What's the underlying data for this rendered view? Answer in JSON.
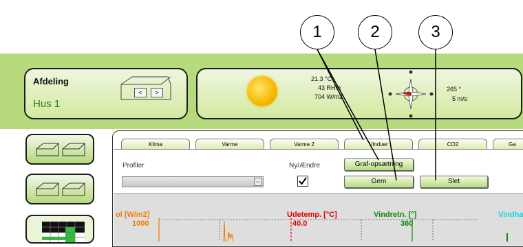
{
  "callouts": [
    "1",
    "2",
    "3"
  ],
  "department": {
    "title": "Afdeling",
    "house": "Hus 1",
    "prev": "<",
    "next": ">"
  },
  "weather": {
    "temperature": "21.3 °C",
    "humidity": "43 RH%",
    "radiation": "704 W/m2",
    "wind_direction": "265 °",
    "wind_speed": "5 m/s"
  },
  "tabs": [
    "Klima",
    "Varme",
    "Varme 2",
    "Vinduer",
    "CO2",
    "Ga"
  ],
  "controls": {
    "profiles_label": "Profiler",
    "new_edit_label": "Ny/Ændre",
    "graph_setup_button": "Graf-opsætning",
    "save_button": "Gem",
    "delete_button": "Slet",
    "checkbox_checked": true
  },
  "chart": {
    "sun_label": "ol [W/m2]",
    "sun_max": "1000",
    "outdoor_temp_label": "Udetemp. [°C]",
    "outdoor_temp_max": "40.0",
    "wind_dir_label": "Vindretn. [°]",
    "wind_dir_max": "360",
    "wind_speed_label": "Vindha"
  },
  "colors": {
    "band": "#b7da7d",
    "sun": "#f07c00",
    "temp": "#e00000",
    "wind_dir": "#0a8a0a",
    "wind_speed": "#00d8e0"
  }
}
